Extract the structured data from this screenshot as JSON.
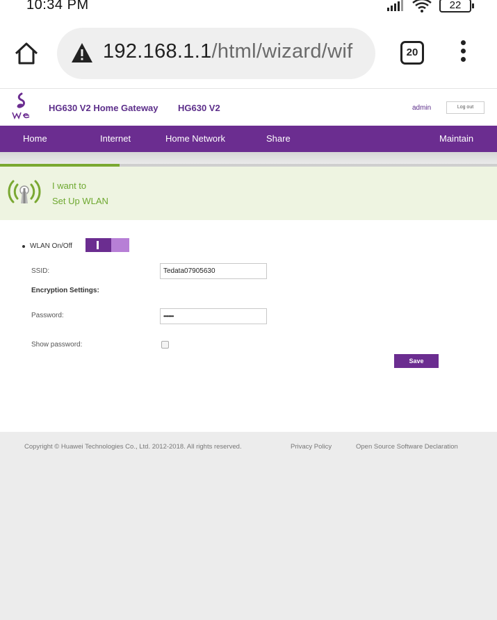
{
  "status_bar": {
    "time": "10:34 PM",
    "battery": "22"
  },
  "browser": {
    "url_host": "192.168.1.1",
    "url_path": "/html/wizard/wif",
    "tab_count": "20"
  },
  "header": {
    "title": "HG630 V2 Home Gateway",
    "model": "HG630 V2",
    "user": "admin",
    "logout_label": "Log out"
  },
  "nav": {
    "items": [
      {
        "label": "Home"
      },
      {
        "label": "Internet"
      },
      {
        "label": "Home Network"
      },
      {
        "label": "Share"
      },
      {
        "label": "Maintain"
      }
    ]
  },
  "wizard": {
    "progress": 0.24,
    "line1": "I want to",
    "line2": "Set Up WLAN"
  },
  "form": {
    "wlan_label": "WLAN On/Off",
    "wlan_enabled": true,
    "ssid_label": "SSID:",
    "ssid_value": "Tedata07905630",
    "encryption_heading": "Encryption Settings:",
    "password_label": "Password:",
    "password_value": "••••••••",
    "show_password_label": "Show password:",
    "show_password_checked": false,
    "save_label": "Save"
  },
  "footer": {
    "copyright": "Copyright © Huawei Technologies Co., Ltd. 2012-2018. All rights reserved.",
    "privacy": "Privacy Policy",
    "open_source": "Open Source Software Declaration"
  },
  "colors": {
    "brand_purple": "#6b2d90",
    "accent_green": "#6ea830",
    "banner_bg": "#eef4e1"
  }
}
